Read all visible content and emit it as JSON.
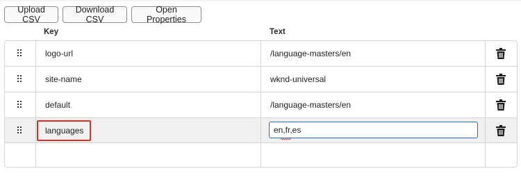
{
  "toolbar": {
    "upload_csv": "Upload CSV",
    "download_csv": "Download CSV",
    "open_properties": "Open Properties"
  },
  "columns": {
    "key": "Key",
    "text": "Text"
  },
  "rows": [
    {
      "key": "logo-url",
      "text": "/language-masters/en"
    },
    {
      "key": "site-name",
      "text": "wknd-universal"
    },
    {
      "key": "default",
      "text": "/language-masters/en"
    },
    {
      "key": "languages",
      "text": "en,fr,es",
      "editing": true
    }
  ],
  "icons": {
    "drag_handle": "drag-handle-icon",
    "delete": "trash-icon"
  },
  "colors": {
    "highlight_border": "#d9302a",
    "focus_border": "#2b6cb5",
    "selected_row_bg": "#f0f0f0"
  }
}
